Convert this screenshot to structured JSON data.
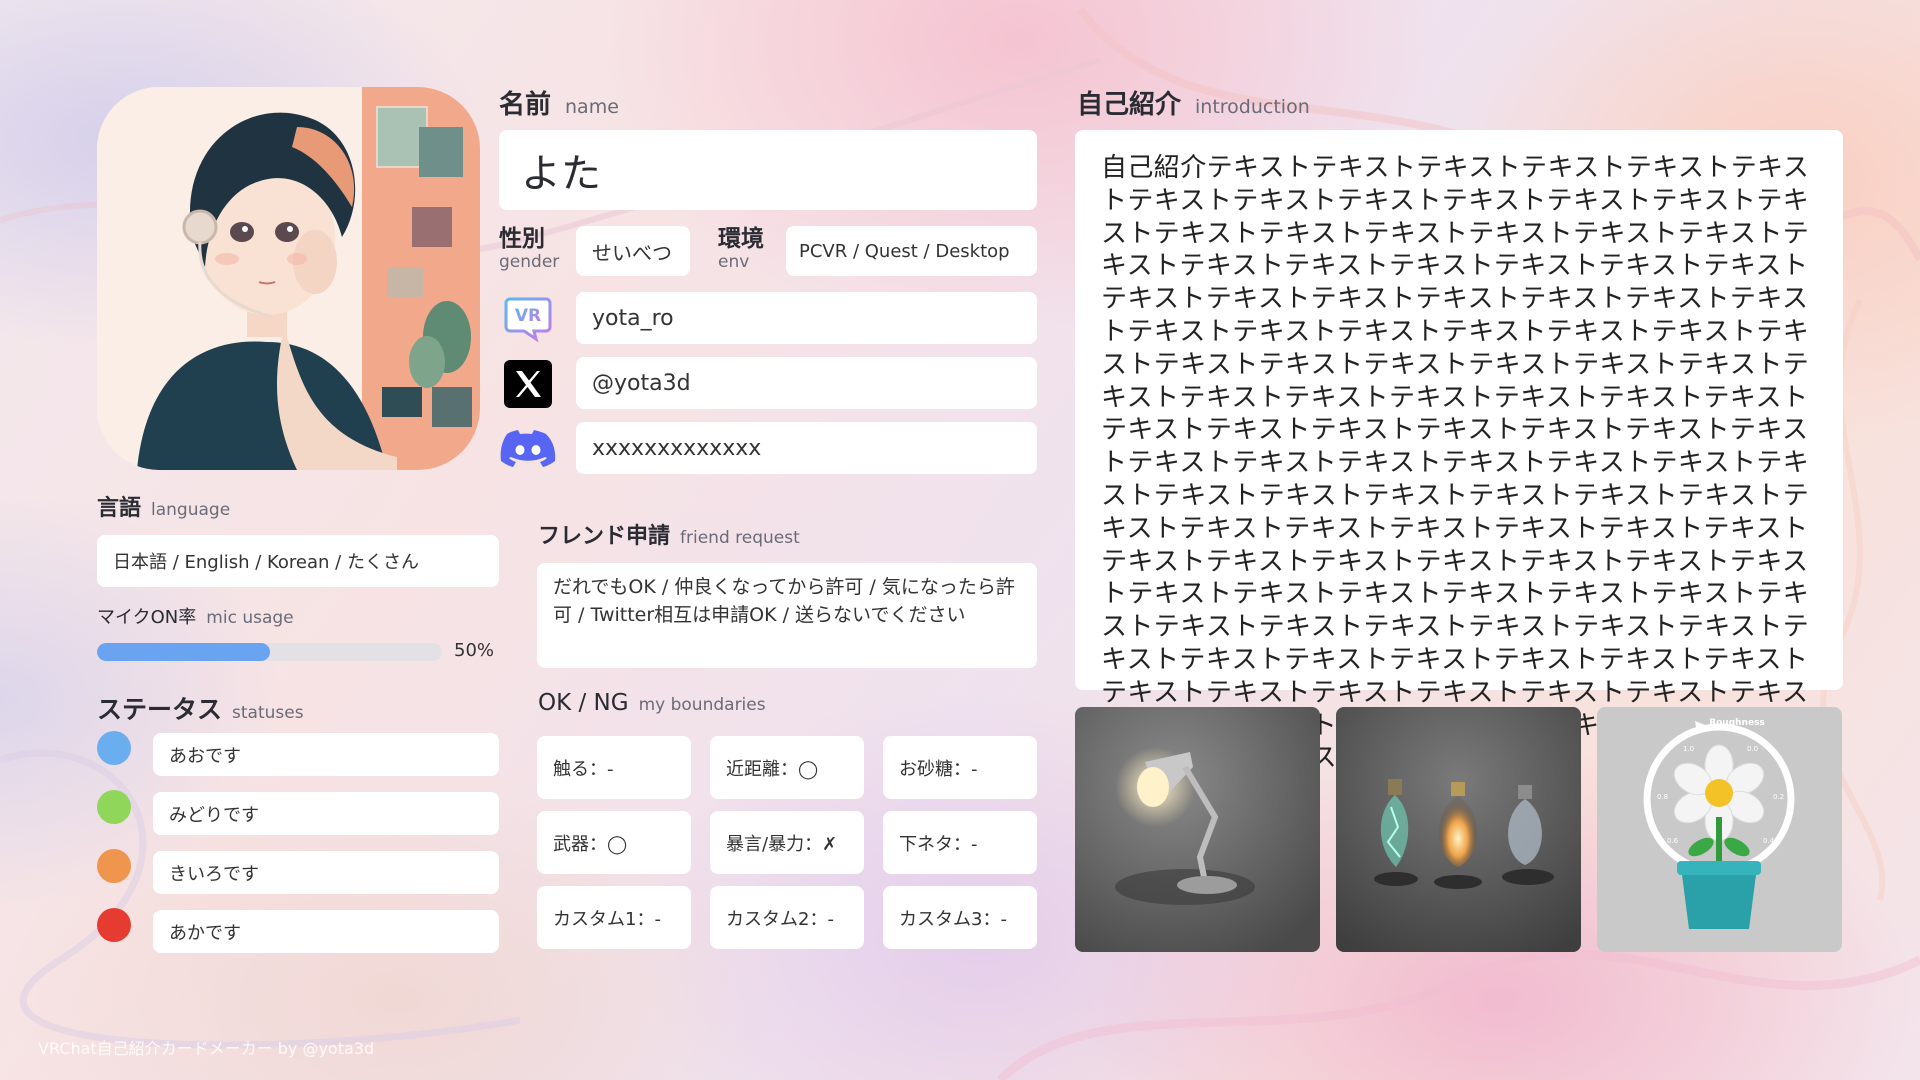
{
  "name": {
    "label_jp": "名前",
    "label_en": "name",
    "value": "よた"
  },
  "gender": {
    "label_jp": "性別",
    "label_en": "gender",
    "value": "せいべつ"
  },
  "env": {
    "label_jp": "環境",
    "label_en": "env",
    "value": "PCVR / Quest / Desktop"
  },
  "socials": {
    "vrchat": {
      "icon": "vrchat-icon",
      "value": "yota_ro"
    },
    "x": {
      "icon": "x-icon",
      "value": "@yota3d"
    },
    "discord": {
      "icon": "discord-icon",
      "value": "xxxxxxxxxxxxx"
    }
  },
  "language": {
    "label_jp": "言語",
    "label_en": "language",
    "value": "日本語 / English / Korean / たくさん"
  },
  "mic": {
    "label_jp": "マイクON率",
    "label_en": "mic usage",
    "value_text": "50%",
    "percent": 50,
    "color": "#6aa3ef"
  },
  "statuses": {
    "label_jp": "ステータス",
    "label_en": "statuses",
    "items": [
      {
        "color": "#6aaef0",
        "text": "あおです"
      },
      {
        "color": "#8fd65a",
        "text": "みどりです"
      },
      {
        "color": "#f0954e",
        "text": "きいろです"
      },
      {
        "color": "#e53b30",
        "text": "あかです"
      }
    ]
  },
  "friend_request": {
    "label_jp": "フレンド申請",
    "label_en": "friend request",
    "value": "だれでもOK / 仲良くなってから許可 / 気になったら許可 / Twitter相互は申請OK / 送らないでください"
  },
  "boundaries": {
    "label_jp": "OK / NG",
    "label_en": "my boundaries",
    "items": [
      "触る：-",
      "近距離：◯",
      "お砂糖：-",
      "武器：◯",
      "暴言/暴力：✗",
      "下ネタ：-",
      "カスタム1：-",
      "カスタム2：-",
      "カスタム3：-"
    ]
  },
  "introduction": {
    "label_jp": "自己紹介",
    "label_en": "introduction",
    "text": "自己紹介テキストテキストテキストテキストテキストテキストテキストテキストテキストテキストテキストテキストテキストテキストテキストテキストテキストテキストテキストテキストテキストテキストテキストテキストテキストテキストテキストテキストテキストテキストテキストテキストテキストテキストテキストテキストテキストテキストテキストテキストテキストテキストテキストテキストテキストテキストテキストテキストテキストテキストテキストテキストテキストテキストテキストテキストテキストテキストテキストテキストテキストテキストテキストテキストテキストテキストテキストテキストテキストテキストテキストテキストテキストテキストテキストテキストテキストテキストテキストテキストテキストテキストテキストテキストテキストテキストテキストテキストテキストテキストテキストテキストテキストテキストテキストテキストテキストテキストテキストテキストテキストテキストテキストテキストテキストテキストテキストテキストテキストテキストテキストテキストテキストテキストテキストテキストテキストテキストテキストテキストテキストテキストテキストテキスト"
  },
  "photos": {
    "lamp": "desk-lamp-render",
    "bulbs": "light-bulbs-render",
    "flower": {
      "title": "Roughness",
      "ticks": [
        "1.0",
        "0.0",
        "0.8",
        "0.2",
        "0.6",
        "0.4"
      ]
    }
  },
  "footer": "VRChat自己紹介カードメーカー by @yota3d"
}
